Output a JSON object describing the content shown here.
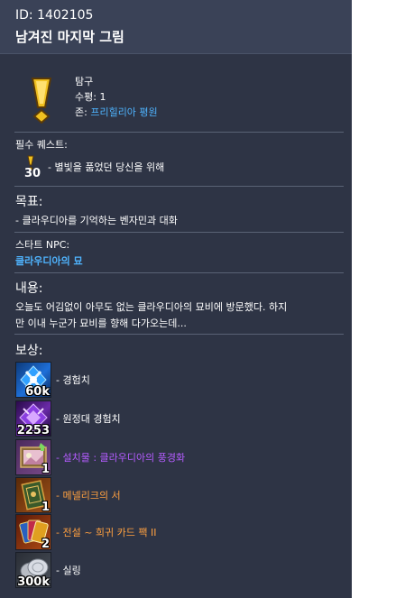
{
  "header": {
    "id_text": "ID: 1402105",
    "title": "남겨진 마지막 그림"
  },
  "quest": {
    "type": "탐구",
    "level_label": "수평: 1",
    "zone_prefix": "존: ",
    "zone_name": "프리힐리아 평원"
  },
  "prereq": {
    "label": "필수 퀘스트:",
    "level": "30",
    "text": "- 별빛을 품었던 당신을 위해"
  },
  "objective": {
    "label": "목표:",
    "text": "- 클라우디아를 기억하는 벤자민과 대화"
  },
  "start_npc": {
    "label": "스타트 NPC:",
    "name": "클라우디아의 묘"
  },
  "content": {
    "label": "내용:",
    "line1": "오늘도 어김없이 아무도 없는 클라우디아의 묘비에 방문했다. 하지",
    "line2": "만 이내 누군가 묘비를 향해 다가오는데..."
  },
  "rewards": {
    "label": "보상:",
    "items": [
      {
        "label": "- 경험치",
        "count": "60k",
        "icon": "exp-icon",
        "color": "#ffffff"
      },
      {
        "label": "- 원정대 경험치",
        "count": "2253",
        "icon": "roster-exp-icon",
        "color": "#ffffff"
      },
      {
        "label": "- 설치물 : 클라우디아의 풍경화",
        "count": "1",
        "icon": "painting-icon",
        "color": "#b45cff"
      },
      {
        "label": "- 메넬리크의 서",
        "count": "1",
        "icon": "book-icon",
        "color": "#ffa040"
      },
      {
        "label": "- 전설 ~ 희귀 카드 팩 II",
        "count": "2",
        "icon": "card-pack-icon",
        "color": "#ffa040"
      },
      {
        "label": "- 실링",
        "count": "300k",
        "icon": "silver-coin-icon",
        "color": "#ffffff"
      }
    ]
  }
}
